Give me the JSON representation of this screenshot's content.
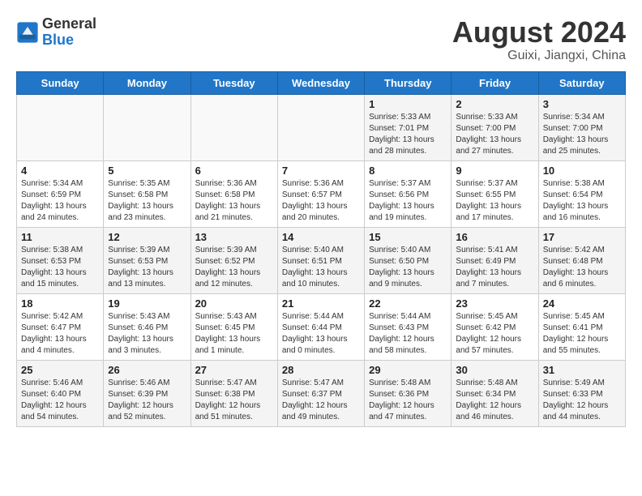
{
  "header": {
    "logo_line1": "General",
    "logo_line2": "Blue",
    "month": "August 2024",
    "location": "Guixi, Jiangxi, China"
  },
  "weekdays": [
    "Sunday",
    "Monday",
    "Tuesday",
    "Wednesday",
    "Thursday",
    "Friday",
    "Saturday"
  ],
  "weeks": [
    [
      {
        "day": "",
        "info": ""
      },
      {
        "day": "",
        "info": ""
      },
      {
        "day": "",
        "info": ""
      },
      {
        "day": "",
        "info": ""
      },
      {
        "day": "1",
        "info": "Sunrise: 5:33 AM\nSunset: 7:01 PM\nDaylight: 13 hours\nand 28 minutes."
      },
      {
        "day": "2",
        "info": "Sunrise: 5:33 AM\nSunset: 7:00 PM\nDaylight: 13 hours\nand 27 minutes."
      },
      {
        "day": "3",
        "info": "Sunrise: 5:34 AM\nSunset: 7:00 PM\nDaylight: 13 hours\nand 25 minutes."
      }
    ],
    [
      {
        "day": "4",
        "info": "Sunrise: 5:34 AM\nSunset: 6:59 PM\nDaylight: 13 hours\nand 24 minutes."
      },
      {
        "day": "5",
        "info": "Sunrise: 5:35 AM\nSunset: 6:58 PM\nDaylight: 13 hours\nand 23 minutes."
      },
      {
        "day": "6",
        "info": "Sunrise: 5:36 AM\nSunset: 6:58 PM\nDaylight: 13 hours\nand 21 minutes."
      },
      {
        "day": "7",
        "info": "Sunrise: 5:36 AM\nSunset: 6:57 PM\nDaylight: 13 hours\nand 20 minutes."
      },
      {
        "day": "8",
        "info": "Sunrise: 5:37 AM\nSunset: 6:56 PM\nDaylight: 13 hours\nand 19 minutes."
      },
      {
        "day": "9",
        "info": "Sunrise: 5:37 AM\nSunset: 6:55 PM\nDaylight: 13 hours\nand 17 minutes."
      },
      {
        "day": "10",
        "info": "Sunrise: 5:38 AM\nSunset: 6:54 PM\nDaylight: 13 hours\nand 16 minutes."
      }
    ],
    [
      {
        "day": "11",
        "info": "Sunrise: 5:38 AM\nSunset: 6:53 PM\nDaylight: 13 hours\nand 15 minutes."
      },
      {
        "day": "12",
        "info": "Sunrise: 5:39 AM\nSunset: 6:53 PM\nDaylight: 13 hours\nand 13 minutes."
      },
      {
        "day": "13",
        "info": "Sunrise: 5:39 AM\nSunset: 6:52 PM\nDaylight: 13 hours\nand 12 minutes."
      },
      {
        "day": "14",
        "info": "Sunrise: 5:40 AM\nSunset: 6:51 PM\nDaylight: 13 hours\nand 10 minutes."
      },
      {
        "day": "15",
        "info": "Sunrise: 5:40 AM\nSunset: 6:50 PM\nDaylight: 13 hours\nand 9 minutes."
      },
      {
        "day": "16",
        "info": "Sunrise: 5:41 AM\nSunset: 6:49 PM\nDaylight: 13 hours\nand 7 minutes."
      },
      {
        "day": "17",
        "info": "Sunrise: 5:42 AM\nSunset: 6:48 PM\nDaylight: 13 hours\nand 6 minutes."
      }
    ],
    [
      {
        "day": "18",
        "info": "Sunrise: 5:42 AM\nSunset: 6:47 PM\nDaylight: 13 hours\nand 4 minutes."
      },
      {
        "day": "19",
        "info": "Sunrise: 5:43 AM\nSunset: 6:46 PM\nDaylight: 13 hours\nand 3 minutes."
      },
      {
        "day": "20",
        "info": "Sunrise: 5:43 AM\nSunset: 6:45 PM\nDaylight: 13 hours\nand 1 minute."
      },
      {
        "day": "21",
        "info": "Sunrise: 5:44 AM\nSunset: 6:44 PM\nDaylight: 13 hours\nand 0 minutes."
      },
      {
        "day": "22",
        "info": "Sunrise: 5:44 AM\nSunset: 6:43 PM\nDaylight: 12 hours\nand 58 minutes."
      },
      {
        "day": "23",
        "info": "Sunrise: 5:45 AM\nSunset: 6:42 PM\nDaylight: 12 hours\nand 57 minutes."
      },
      {
        "day": "24",
        "info": "Sunrise: 5:45 AM\nSunset: 6:41 PM\nDaylight: 12 hours\nand 55 minutes."
      }
    ],
    [
      {
        "day": "25",
        "info": "Sunrise: 5:46 AM\nSunset: 6:40 PM\nDaylight: 12 hours\nand 54 minutes."
      },
      {
        "day": "26",
        "info": "Sunrise: 5:46 AM\nSunset: 6:39 PM\nDaylight: 12 hours\nand 52 minutes."
      },
      {
        "day": "27",
        "info": "Sunrise: 5:47 AM\nSunset: 6:38 PM\nDaylight: 12 hours\nand 51 minutes."
      },
      {
        "day": "28",
        "info": "Sunrise: 5:47 AM\nSunset: 6:37 PM\nDaylight: 12 hours\nand 49 minutes."
      },
      {
        "day": "29",
        "info": "Sunrise: 5:48 AM\nSunset: 6:36 PM\nDaylight: 12 hours\nand 47 minutes."
      },
      {
        "day": "30",
        "info": "Sunrise: 5:48 AM\nSunset: 6:34 PM\nDaylight: 12 hours\nand 46 minutes."
      },
      {
        "day": "31",
        "info": "Sunrise: 5:49 AM\nSunset: 6:33 PM\nDaylight: 12 hours\nand 44 minutes."
      }
    ]
  ]
}
